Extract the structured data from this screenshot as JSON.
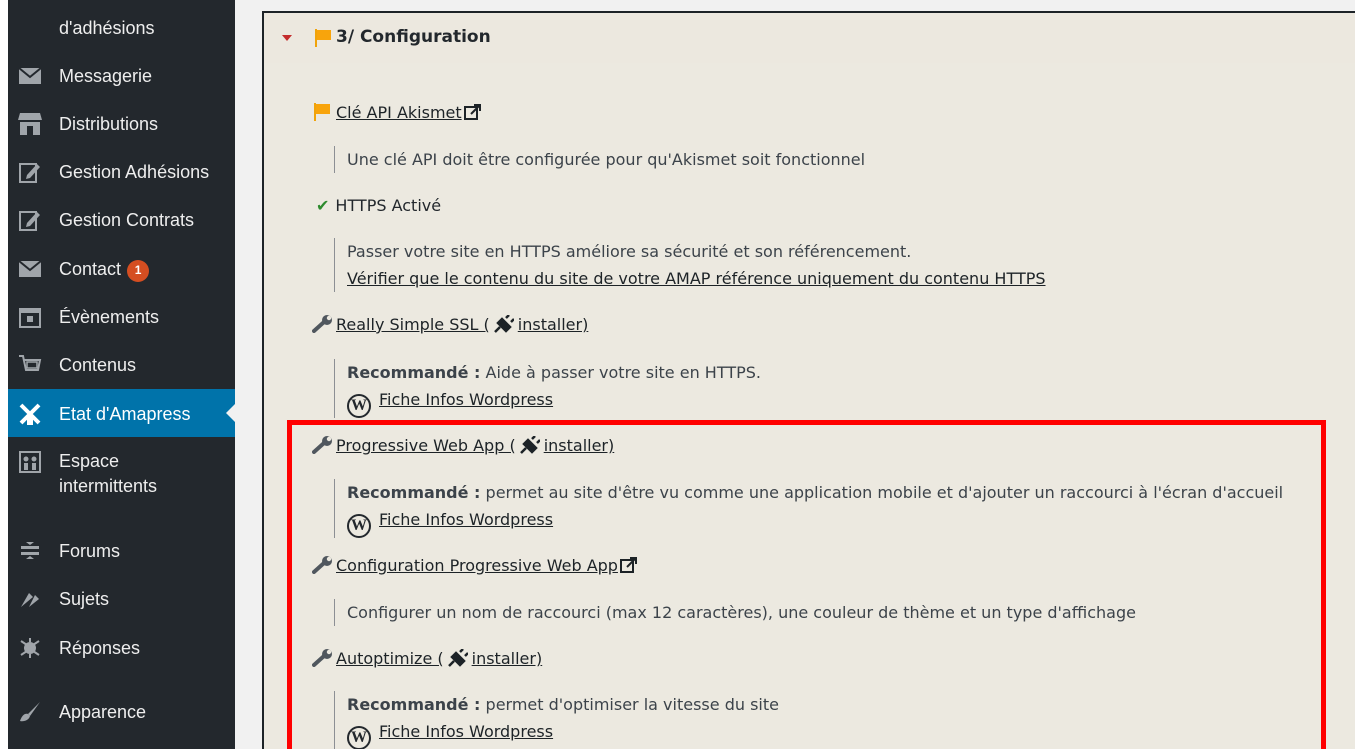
{
  "sidebar": {
    "items": [
      {
        "label": "d'adhésions",
        "icon": "none"
      },
      {
        "label": "Messagerie",
        "icon": "envelope-icon"
      },
      {
        "label": "Distributions",
        "icon": "store-icon"
      },
      {
        "label": "Gestion Adhésions",
        "icon": "edit-icon"
      },
      {
        "label": "Gestion Contrats",
        "icon": "edit-icon"
      },
      {
        "label": "Contact",
        "icon": "envelope-icon",
        "badge": "1"
      },
      {
        "label": "Évènements",
        "icon": "calendar-icon"
      },
      {
        "label": "Contenus",
        "icon": "cart-icon"
      },
      {
        "label": "Etat d'Amapress",
        "icon": "windmill-icon",
        "active": true
      },
      {
        "label": "Espace intermittents",
        "icon": "people-icon"
      },
      {
        "label": "Forums",
        "icon": "forums-icon"
      },
      {
        "label": "Sujets",
        "icon": "topics-icon"
      },
      {
        "label": "Réponses",
        "icon": "replies-icon"
      },
      {
        "label": "Apparence",
        "icon": "brush-icon"
      }
    ]
  },
  "section": {
    "title": "3/ Configuration"
  },
  "entries": {
    "akismet": {
      "label": "Clé API Akismet",
      "desc": "Une clé API doit être configurée pour qu'Akismet soit fonctionnel"
    },
    "https": {
      "label": "HTTPS Activé",
      "desc": "Passer votre site en HTTPS améliore sa sécurité et son référencement.",
      "link": "Vérifier que le contenu du site de votre AMAP référence uniquement du contenu HTTPS"
    },
    "ssl": {
      "label": "Really Simple SSL (",
      "install": "installer)",
      "recommended": "Recommandé :",
      "desc": " Aide à passer votre site en HTTPS.",
      "fiche": "Fiche Infos Wordpress"
    },
    "pwa": {
      "label": "Progressive Web App (",
      "install": "installer)",
      "recommended": "Recommandé :",
      "desc": " permet au site d'être vu comme une application mobile et d'ajouter un raccourci à l'écran d'accueil",
      "fiche": "Fiche Infos Wordpress"
    },
    "pwa_config": {
      "label": "Configuration Progressive Web App",
      "desc": "Configurer un nom de raccourci (max 12 caractères), une couleur de thème et un type d'affichage"
    },
    "autoptimize": {
      "label": "Autoptimize (",
      "install": "installer)",
      "recommended": "Recommandé :",
      "desc": " permet d'optimiser la vitesse du site",
      "fiche": "Fiche Infos Wordpress"
    }
  },
  "colors": {
    "sidebar_bg": "#23282d",
    "active_bg": "#0073aa",
    "panel_bg": "#ece9e0",
    "flag": "#f8a40c",
    "highlight": "#ff0000",
    "check": "#2e8b2e"
  }
}
